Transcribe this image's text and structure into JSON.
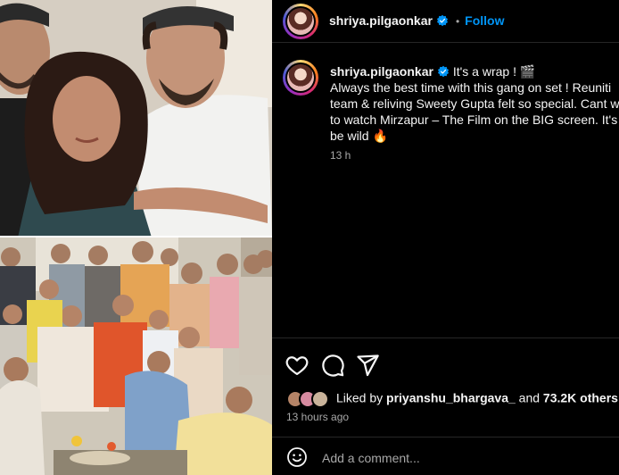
{
  "header": {
    "username": "shriya.pilgaonkar",
    "separator": "•",
    "follow_label": "Follow"
  },
  "caption": {
    "username": "shriya.pilgaonkar",
    "line1": "It's a wrap ! 🎬",
    "line2": "Always the best time with this gang on set ! Reuniti",
    "line3": "team & reliving Sweety Gupta felt so special. Cant w",
    "line4": "to watch Mirzapur – The Film on the BIG screen. It's",
    "line5": "be wild 🔥",
    "time": "13 h"
  },
  "engagement": {
    "liked_by_prefix": "Liked by",
    "liked_by_user": "priyanshu_bhargava_",
    "and_text": "and",
    "others_text": "73.2K others",
    "timestamp": "13 hours ago"
  },
  "comment": {
    "placeholder": "Add a comment..."
  },
  "icons": [
    "verified-badge-icon",
    "heart-icon",
    "comment-icon",
    "share-icon",
    "emoji-icon"
  ],
  "colors": {
    "accent": "#0095f6",
    "muted": "#a8a8a8",
    "background": "#000000"
  }
}
